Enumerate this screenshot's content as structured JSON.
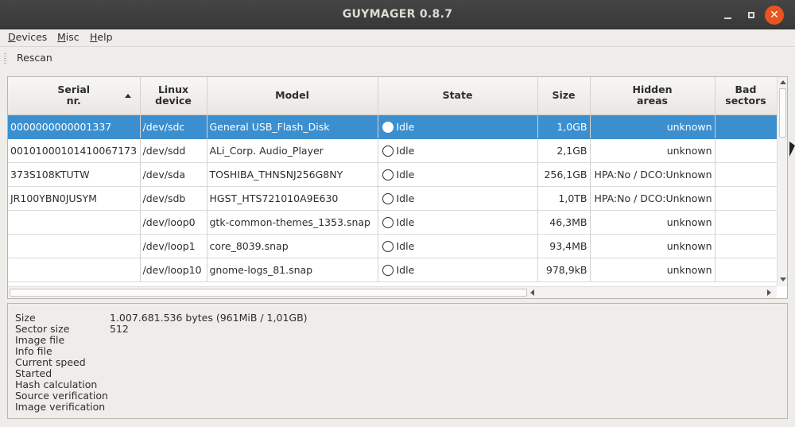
{
  "window": {
    "title": "GUYMAGER 0.8.7",
    "close_glyph": "✕"
  },
  "menu": [
    {
      "underline": "D",
      "rest": "evices"
    },
    {
      "underline": "M",
      "rest": "isc"
    },
    {
      "underline": "H",
      "rest": "elp"
    }
  ],
  "toolbar": {
    "rescan_label": "Rescan"
  },
  "table": {
    "headers": {
      "serial_1": "Serial",
      "serial_2": "nr.",
      "linux_1": "Linux",
      "linux_2": "device",
      "model": "Model",
      "state": "State",
      "size": "Size",
      "hidden_1": "Hidden",
      "hidden_2": "areas",
      "bad_1": "Bad",
      "bad_2": "sectors"
    },
    "rows": [
      {
        "serial": "0000000000001337",
        "device": "/dev/sdc",
        "model": "General USB_Flash_Disk",
        "state": "Idle",
        "size": "1,0GB",
        "hidden": "unknown",
        "bad": ""
      },
      {
        "serial": "00101000101410067173",
        "device": "/dev/sdd",
        "model": "ALi_Corp. Audio_Player",
        "state": "Idle",
        "size": "2,1GB",
        "hidden": "unknown",
        "bad": ""
      },
      {
        "serial": "373S108KTUTW",
        "device": "/dev/sda",
        "model": "TOSHIBA_THNSNJ256G8NY",
        "state": "Idle",
        "size": "256,1GB",
        "hidden": "HPA:No / DCO:Unknown",
        "bad": ""
      },
      {
        "serial": "JR100YBN0JUSYM",
        "device": "/dev/sdb",
        "model": "HGST_HTS721010A9E630",
        "state": "Idle",
        "size": "1,0TB",
        "hidden": "HPA:No / DCO:Unknown",
        "bad": ""
      },
      {
        "serial": "",
        "device": "/dev/loop0",
        "model": "gtk-common-themes_1353.snap",
        "state": "Idle",
        "size": "46,3MB",
        "hidden": "unknown",
        "bad": ""
      },
      {
        "serial": "",
        "device": "/dev/loop1",
        "model": "core_8039.snap",
        "state": "Idle",
        "size": "93,4MB",
        "hidden": "unknown",
        "bad": ""
      },
      {
        "serial": "",
        "device": "/dev/loop10",
        "model": "gnome-logs_81.snap",
        "state": "Idle",
        "size": "978,9kB",
        "hidden": "unknown",
        "bad": ""
      }
    ]
  },
  "info": {
    "labels": [
      "Size",
      "Sector size",
      "Image file",
      "Info file",
      "Current speed",
      "Started",
      "Hash calculation",
      "Source verification",
      "Image verification"
    ],
    "values": [
      "1.007.681.536 bytes (961MiB / 1,01GB)",
      "512",
      "",
      "",
      "",
      "",
      "",
      "",
      ""
    ]
  }
}
